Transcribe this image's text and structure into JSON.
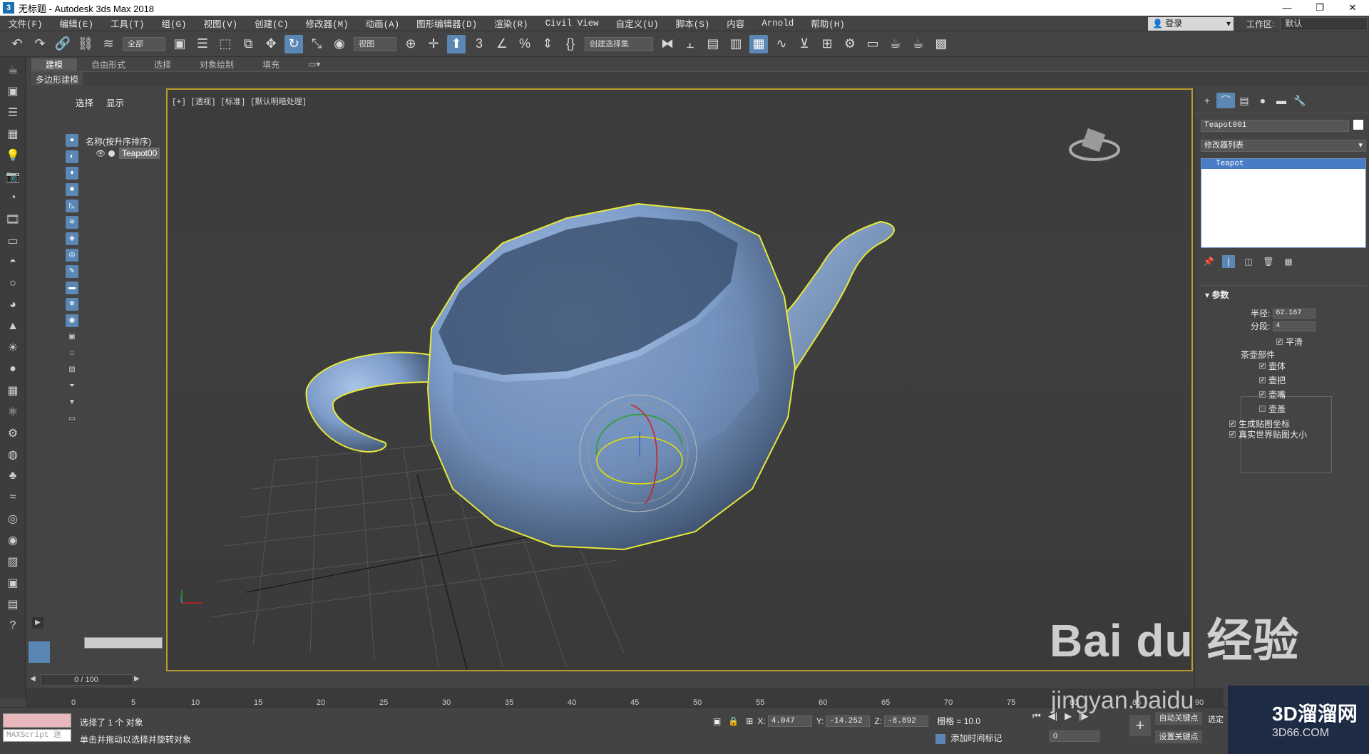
{
  "window": {
    "app_icon": "3",
    "title": "无标题 - Autodesk 3ds Max 2018",
    "min": "—",
    "restore": "❐",
    "close": "✕"
  },
  "menu": [
    "文件(F)",
    "编辑(E)",
    "工具(T)",
    "组(G)",
    "视图(V)",
    "创建(C)",
    "修改器(M)",
    "动画(A)",
    "图形编辑器(D)",
    "渲染(R)",
    "Civil View",
    "自定义(U)",
    "脚本(S)",
    "内容",
    "Arnold",
    "帮助(H)"
  ],
  "login": "登录",
  "workspace": {
    "label": "工作区:",
    "value": "默认"
  },
  "toolbar": {
    "filter": "全部",
    "ref_coord": "视图",
    "selection_set": "创建选择集"
  },
  "ribbon": {
    "tabs": [
      "建模",
      "自由形式",
      "选择",
      "对象绘制",
      "填充"
    ],
    "sub": "多边形建模"
  },
  "scene_explorer": {
    "tabs": [
      "选择",
      "显示"
    ],
    "header": "名称(按升序排序)",
    "object": "Teapot00"
  },
  "viewport": {
    "label": "[+] [透视] [标准] [默认明暗处理]"
  },
  "command_panel": {
    "object_name": "Teapot001",
    "modifier_list": "修改器列表",
    "stack_item": "Teapot",
    "rollout": "参数",
    "radius_label": "半径:",
    "radius": "62.167",
    "segments_label": "分段:",
    "segments": "4",
    "smooth": "平滑",
    "parts_label": "茶壶部件",
    "parts": [
      "壶体",
      "壶把",
      "壶嘴",
      "壶盖"
    ],
    "gen_map": "生成贴图坐标",
    "real_world": "真实世界贴图大小"
  },
  "timeline": {
    "frame": "0 / 100",
    "ticks": [
      "0",
      "5",
      "10",
      "15",
      "20",
      "25",
      "30",
      "35",
      "40",
      "45",
      "50",
      "55",
      "60",
      "65",
      "70",
      "75",
      "80",
      "85",
      "90"
    ]
  },
  "status": {
    "maxscript": "MAXScript 迷",
    "line1": "选择了 1 个 对象",
    "line2": "单击并拖动以选择并旋转对象",
    "x": "4.047",
    "y": "-14.252",
    "z": "-8.892",
    "grid": "栅格 = 10.0",
    "add_time_tag": "添加时间标记",
    "auto_key": "自动关键点",
    "set_key": "设置关键点",
    "select": "选定",
    "frame_field": "0"
  },
  "watermarks": {
    "baidu": "Bai du 经验",
    "jingyan": "jingyan.baidu",
    "site": "3D溜溜网",
    "site_sub": "3D66.COM"
  }
}
